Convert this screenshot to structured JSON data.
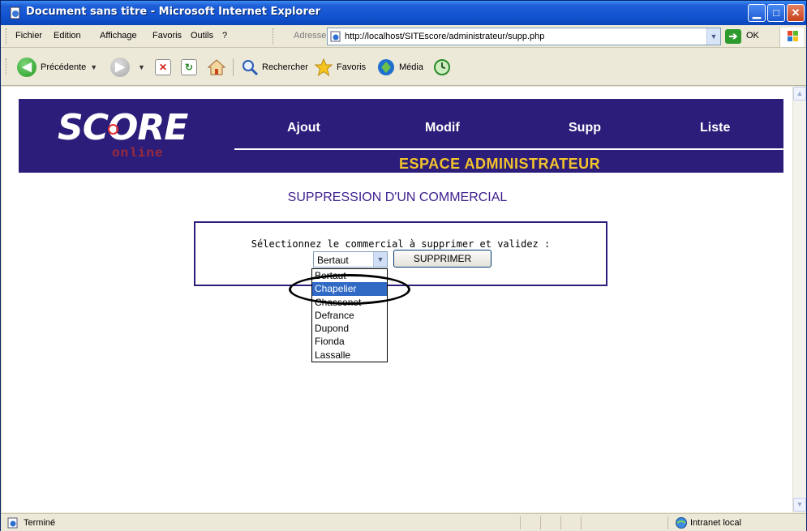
{
  "window": {
    "title": "Document sans titre - Microsoft Internet Explorer",
    "minimize": "▁",
    "maximize": "□",
    "close": "✕"
  },
  "menu": {
    "items": [
      "Fichier",
      "Edition",
      "Affichage",
      "Favoris",
      "Outils",
      "?"
    ],
    "address_label": "Adresse",
    "address_value": "http://localhost/SITEscore/administrateur/supp.php",
    "go_label": "OK"
  },
  "toolbar": {
    "back": "Précédente",
    "search": "Rechercher",
    "favorites": "Favoris",
    "media": "Média"
  },
  "site": {
    "logo": "SCORE",
    "logo_sub": "online",
    "nav": [
      "Ajout",
      "Modif",
      "Supp",
      "Liste"
    ],
    "espace": "ESPACE ADMINISTRATEUR"
  },
  "page": {
    "heading": "SUPPRESSION D'UN COMMERCIAL",
    "form_label": "Sélectionnez le commercial à supprimer et validez :",
    "select_value": "Bertaut",
    "submit_label": "SUPPRIMER",
    "options": [
      "Bertaut",
      "Chapelier",
      "Chassenet",
      "Defrance",
      "Dupond",
      "Fionda",
      "Lassalle"
    ],
    "highlighted_option": "Chapelier"
  },
  "status": {
    "text": "Terminé",
    "zone": "Intranet local"
  },
  "colors": {
    "site_header": "#2d1d7a",
    "espace_text": "#f2c32c",
    "heading_text": "#3d1f8e",
    "selection": "#316ac5"
  }
}
